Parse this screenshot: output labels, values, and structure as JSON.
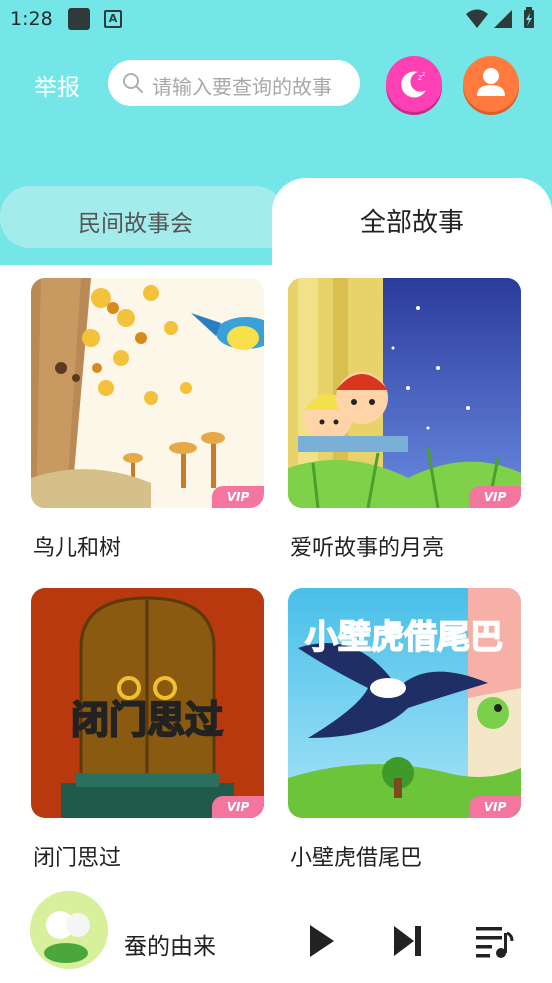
{
  "status": {
    "time": "1:28"
  },
  "header": {
    "report_label": "举报",
    "search_placeholder": "请输入要查询的故事"
  },
  "tabs": [
    {
      "label": "民间故事会",
      "active": false
    },
    {
      "label": "全部故事",
      "active": true
    }
  ],
  "stories": [
    {
      "title": "鸟儿和树",
      "badge": "VIP"
    },
    {
      "title": "爱听故事的月亮",
      "badge": "VIP"
    },
    {
      "title": "闭门思过",
      "badge": "VIP",
      "cover_text": "闭门思过"
    },
    {
      "title": "小壁虎借尾巴",
      "badge": "VIP",
      "cover_text": "小壁虎借尾巴"
    }
  ],
  "player": {
    "now_playing": "蚕的由来"
  },
  "colors": {
    "header_bg": "#75e6e8",
    "vip_badge": "#f4769f",
    "moon_button": "#ff3fb4",
    "user_button": "#ff7a3c"
  },
  "icons": [
    "search-icon",
    "moon-icon",
    "user-icon",
    "play-icon",
    "next-icon",
    "playlist-icon",
    "wifi-icon",
    "signal-icon",
    "battery-icon"
  ]
}
